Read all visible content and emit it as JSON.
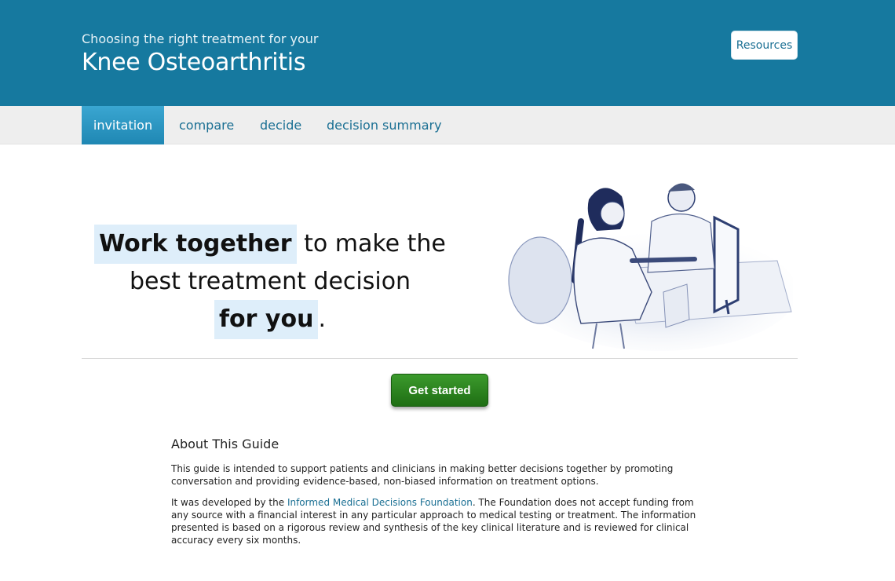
{
  "header": {
    "subtitle": "Choosing the right treatment for your",
    "title": "Knee Osteoarthritis",
    "resources_label": "Resources"
  },
  "nav": {
    "tabs": [
      {
        "label": "invitation",
        "active": true
      },
      {
        "label": "compare",
        "active": false
      },
      {
        "label": "decide",
        "active": false
      },
      {
        "label": "decision summary",
        "active": false
      }
    ]
  },
  "hero": {
    "highlight1": "Work together",
    "text1": " to make the",
    "text2": "best treatment decision ",
    "highlight2": "for you",
    "text3": ".",
    "illustration_icon": "doctor-patient-illustration"
  },
  "cta": {
    "label": "Get started"
  },
  "about": {
    "heading": "About This Guide",
    "para1": "This guide is intended to support patients and clinicians in making better decisions together by promoting conversation and providing evidence-based, non-biased information on treatment options.",
    "para2_prefix": "It was developed by the ",
    "para2_link": "Informed Medical Decisions Foundation",
    "para2_suffix": ". The Foundation does not accept funding from any source with a financial interest in any particular approach to medical testing or treatment. The information presented is based on a rigorous review and synthesis of the key clinical literature and is reviewed for clinical accuracy every six months."
  },
  "colors": {
    "header_bg": "#16799f",
    "accent_link": "#1a6f93",
    "cta_green": "#2a8220",
    "highlight_bg": "#deeefa"
  }
}
